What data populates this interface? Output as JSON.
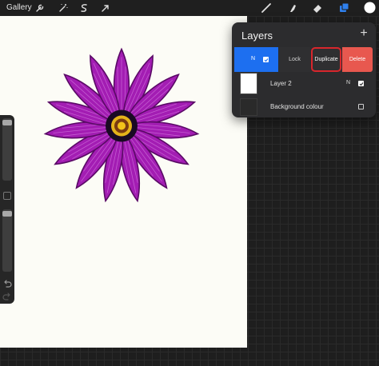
{
  "topbar": {
    "gallery_label": "Gallery",
    "left_tools": [
      "wrench-icon",
      "magic-wand-icon",
      "selection-icon",
      "transform-arrow-icon"
    ],
    "right_tools": [
      "brush-icon",
      "smudge-icon",
      "eraser-icon",
      "layers-icon",
      "color-swatch"
    ],
    "layers_icon_color": "#2f80ed",
    "color_swatch": "#ffffff"
  },
  "canvas": {
    "background": "#fcfcf6",
    "flower_petal_color": "#a020b0",
    "flower_center_color": "#f2c21a"
  },
  "layers_panel": {
    "title": "Layers",
    "add_label": "+",
    "active_layer": {
      "blend_mode": "N",
      "visible": true
    },
    "actions": {
      "lock": "Lock",
      "duplicate": "Duplicate",
      "delete": "Delete"
    },
    "layers": [
      {
        "name": "Layer 2",
        "blend_mode": "N",
        "visible": true
      },
      {
        "name": "Background colour",
        "visible": false
      }
    ]
  }
}
